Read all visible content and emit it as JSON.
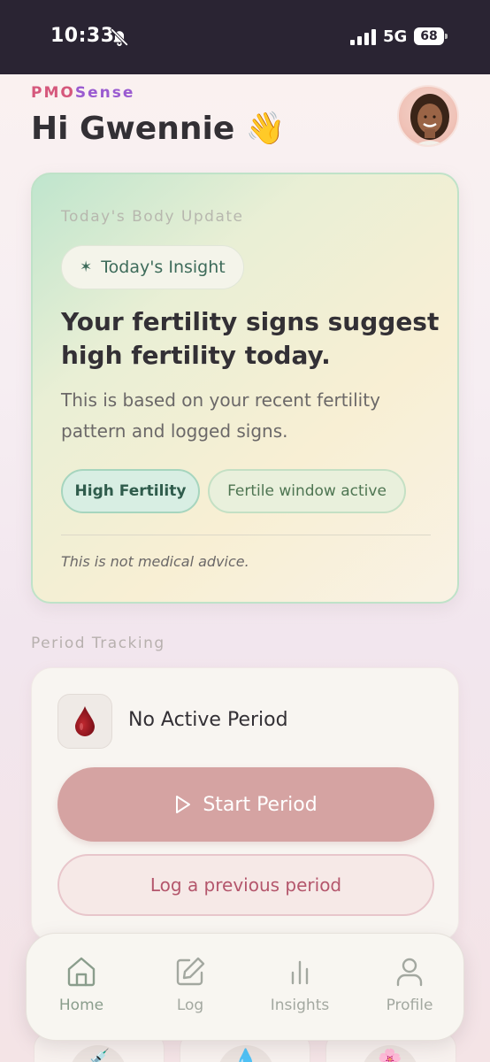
{
  "status_bar": {
    "time": "10:33",
    "network": "5G",
    "battery": "68"
  },
  "header": {
    "brand_part1": "PMO",
    "brand_part2": "Sense",
    "greeting": "Hi Gwennie 👋"
  },
  "insight_card": {
    "eyebrow": "Today's Body Update",
    "pill_icon": "✶",
    "pill_label": "Today's Insight",
    "title": "Your fertility signs suggest high fertility today.",
    "body": "This is based on your recent fertility pattern and logged signs.",
    "tags": [
      "High Fertility",
      "Fertile window active"
    ],
    "disclaimer": "This is not medical advice."
  },
  "period_tracking": {
    "section_title": "Period Tracking",
    "status": "No Active Period",
    "start_button": "Start Period",
    "log_previous_button": "Log a previous period"
  },
  "tab_bar": {
    "tabs": [
      {
        "label": "Home",
        "icon": "home-icon"
      },
      {
        "label": "Log",
        "icon": "edit-icon"
      },
      {
        "label": "Insights",
        "icon": "bar-chart-icon"
      },
      {
        "label": "Profile",
        "icon": "user-icon"
      }
    ],
    "active": "Home"
  },
  "bottom_tiles": [
    "💉",
    "💧",
    "🌸"
  ],
  "colors": {
    "accent_pink": "#d5587c",
    "accent_purple": "#9a5bd0",
    "start_button": "#d5a3a2",
    "fertility_green": "#a6d5be"
  }
}
